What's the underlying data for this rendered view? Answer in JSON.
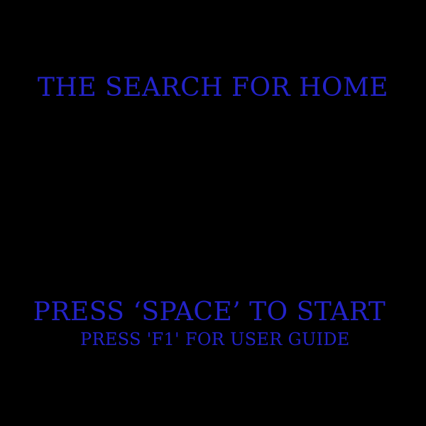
{
  "game": {
    "title": "The Search for Home",
    "start_prompt": "Press ‘Space’ to Start",
    "guide_prompt": "Press 'F1' for User Guide"
  },
  "colors": {
    "background": "#000000",
    "text": "#2323c8"
  }
}
